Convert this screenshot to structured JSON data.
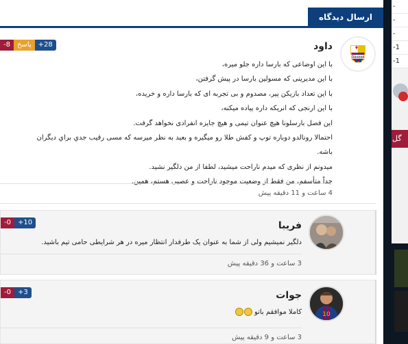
{
  "header": {
    "tab_label": "ارسال دیدگاه"
  },
  "sidebar": {
    "rows": [
      "-",
      "-",
      "-",
      "-1",
      "-1"
    ],
    "red_label": "گل"
  },
  "comments": [
    {
      "name": "داود",
      "avatar_label": "Davood",
      "votes": {
        "positive": "+28",
        "reply": "پاسخ",
        "negative": "-8"
      },
      "lines": [
        "با این اوضاعی که بارسا داره جلو میره،",
        "با این مدیرینی که مسولین بارسا در پیش گرفتن،",
        "با این تعداد بازیکن پیر، مصدوم و بی تجربه ای که بارسا داره و خریده،",
        "با این ارنجی که انریکه داره پیاده میکنه،",
        "این فصل بارسلونا هیچ عنوان تیمی و هیچ جایزه انفرادی نخواهد گرفت.",
        "احتمالا رونالدو دوباره توپ و کفش طلا رو میگیره و بعید به نظر میرسه که مسی رقیب جدي براي ديگران",
        "باشه.",
        "میدونم از نظری که میدم ناراحت میشید، لطفا از من دلگیر نشید.",
        "جداً متأسفم، من فقط از وضعیت موجود ناراحت و عصبی هستم، همین."
      ],
      "time": "4 ساعت و 11 دقیقه پیش"
    },
    {
      "name": "فریبا",
      "votes": {
        "positive": "+10",
        "negative": "-0"
      },
      "lines": [
        "دلگیر نمیشیم ولی از شما به عنوان یک طرفدار انتظار میره در هر شرایطی حامی تیم باشید."
      ],
      "time": "3 ساعت و 36 دقیقه پیش"
    },
    {
      "name": "جوات",
      "votes": {
        "positive": "+3",
        "negative": "-0"
      },
      "lines": [
        "کاملا موافقم باتو"
      ],
      "time": "3 ساعت و 9 دقیقه پیش"
    }
  ]
}
